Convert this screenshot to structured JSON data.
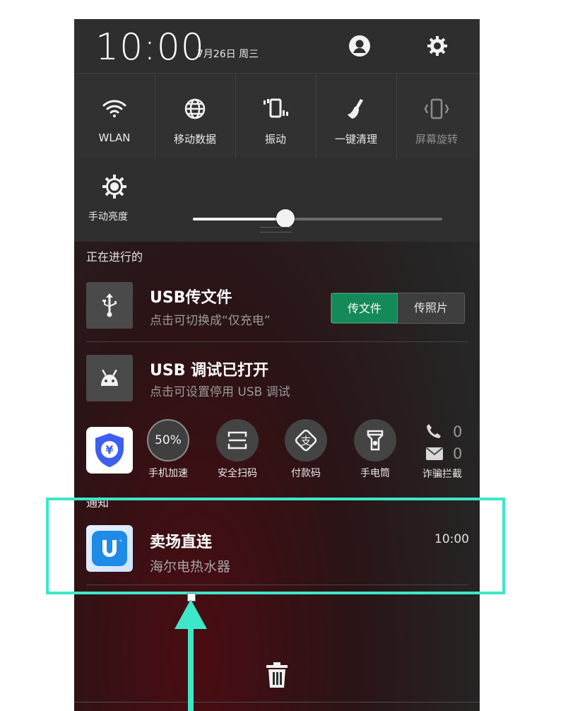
{
  "status_bar": {
    "time": "10:00",
    "date": "7月26日 周三",
    "icons": [
      "user-icon",
      "gear-icon"
    ]
  },
  "quick_settings": [
    {
      "label": "WLAN",
      "icon": "wifi-icon",
      "active": true
    },
    {
      "label": "移动数据",
      "icon": "globe-icon",
      "active": true
    },
    {
      "label": "振动",
      "icon": "vibrate-icon",
      "active": true
    },
    {
      "label": "一键清理",
      "icon": "broom-icon",
      "active": true
    },
    {
      "label": "屏幕旋转",
      "icon": "rotate-icon",
      "active": false
    }
  ],
  "brightness": {
    "label": "手动亮度",
    "icon": "brightness-icon",
    "level": 0.37
  },
  "ongoing": {
    "title": "正在进行的",
    "usb_transfer": {
      "title": "USB传文件",
      "subtitle": "点击可切换成“仅充电”",
      "icon": "usb-icon",
      "options": [
        "传文件",
        "传照片"
      ],
      "selected": "传文件"
    },
    "usb_debug": {
      "title": "USB 调试已打开",
      "subtitle": "点击可设置停用 USB 调试",
      "icon": "android-icon"
    }
  },
  "shortcuts": {
    "app_icon": "shield-yen-icon",
    "items": [
      {
        "label": "手机加速",
        "value": "50%",
        "icon": "speed-icon"
      },
      {
        "label": "安全扫码",
        "icon": "scan-icon"
      },
      {
        "label": "付款码",
        "icon": "pay-icon"
      },
      {
        "label": "手电筒",
        "icon": "flashlight-icon"
      }
    ],
    "fraud_block": {
      "label": "诈骗拦截",
      "call_count": "0",
      "sms_count": "0"
    }
  },
  "notifications": {
    "title": "通知",
    "items": [
      {
        "title": "卖场直连",
        "subtitle": "海尔电热水器",
        "time": "10:00",
        "icon": "u-app-icon"
      }
    ]
  },
  "colors": {
    "accent": "#148a58",
    "annotation": "#3de8c8",
    "panel": "#2e2e2e"
  }
}
